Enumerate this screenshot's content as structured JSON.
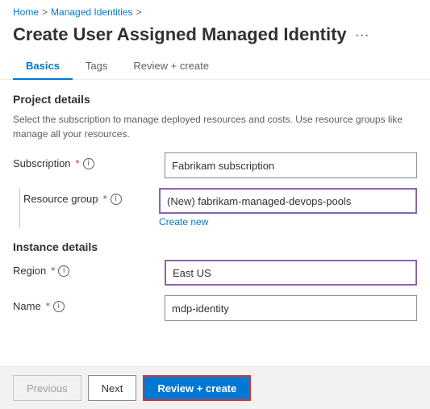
{
  "breadcrumb": {
    "home": "Home",
    "separator1": ">",
    "managed_identities": "Managed Identities",
    "separator2": ">"
  },
  "page": {
    "title": "Create User Assigned Managed Identity",
    "more_icon": "···"
  },
  "tabs": [
    {
      "label": "Basics",
      "active": true
    },
    {
      "label": "Tags",
      "active": false
    },
    {
      "label": "Review + create",
      "active": false
    }
  ],
  "project_details": {
    "title": "Project details",
    "description": "Select the subscription to manage deployed resources and costs. Use resource groups like manage all your resources."
  },
  "fields": {
    "subscription": {
      "label": "Subscription",
      "required": "*",
      "value": "Fabrikam subscription"
    },
    "resource_group": {
      "label": "Resource group",
      "required": "*",
      "value": "(New) fabrikam-managed-devops-pools",
      "create_new": "Create new"
    },
    "region": {
      "label": "Region",
      "required": "*",
      "value": "East US"
    },
    "name": {
      "label": "Name",
      "required": "*",
      "value": "mdp-identity"
    }
  },
  "instance_details": {
    "title": "Instance details"
  },
  "footer": {
    "previous_label": "Previous",
    "next_label": "Next",
    "review_create_label": "Review + create"
  }
}
